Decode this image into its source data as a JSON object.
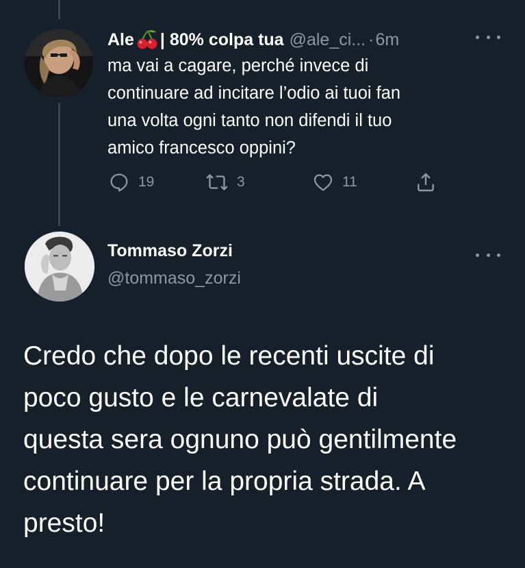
{
  "reply_tweet": {
    "author_name": "Ale",
    "name_suffix": "| 80% colpa tua",
    "emoji": "cherries-emoji",
    "handle": "@ale_ci...",
    "separator": "·",
    "time": "6m",
    "text_lines": [
      "ma vai a cagare, perché invece di",
      "continuare ad incitare l’odio ai tuoi fan",
      "una volta ogni tanto non difendi il tuo",
      "amico francesco oppini?"
    ],
    "actions": {
      "reply_count": "19",
      "retweet_count": "3",
      "like_count": "11"
    }
  },
  "main_tweet": {
    "author_name": "Tommaso Zorzi",
    "handle": "@tommaso_zorzi",
    "text_lines": [
      "Credo che dopo le recenti uscite di",
      "poco gusto e le carnevalate di",
      "questa sera ognuno può gentilmente",
      "continuare per la propria strada. A",
      "presto!"
    ]
  },
  "icons": [
    "more-icon",
    "reply-icon",
    "retweet-icon",
    "like-icon",
    "share-icon",
    "cherries-emoji"
  ],
  "colors": {
    "background": "#15202b",
    "text_primary": "#ffffff",
    "text_secondary": "#8b98a5",
    "thread_line": "#38444d",
    "cherry_red": "#d8202c"
  }
}
